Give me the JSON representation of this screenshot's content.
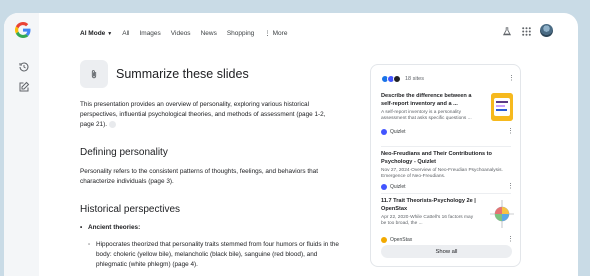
{
  "nav": {
    "items": [
      {
        "label": "AI Mode",
        "active": true,
        "icon": "caret-down"
      },
      {
        "label": "All"
      },
      {
        "label": "Images"
      },
      {
        "label": "Videos"
      },
      {
        "label": "News"
      },
      {
        "label": "Shopping"
      },
      {
        "label": "More",
        "icon": "more-vert"
      }
    ]
  },
  "main": {
    "title": "Summarize these slides",
    "intro": "This presentation provides an overview of personality, exploring various historical perspectives, influential psychological theories, and methods of assessment (page 1-2, page 21).",
    "section1_heading": "Defining personality",
    "section1_text": "Personality refers to the consistent patterns of thoughts, feelings, and behaviors that characterize individuals (page 3).",
    "section2_heading": "Historical perspectives",
    "bullet1": "Ancient theories:",
    "bullet1_sub": "Hippocrates theorized that personality traits stemmed from four humors or fluids in the body: choleric (yellow bile), melancholic (black bile), sanguine (red blood), and phlegmatic (white phlegm) (page 4)."
  },
  "sources": {
    "count_label": "18 sites",
    "cards": [
      {
        "title": "Describe the difference between a self-report inventory and a ...",
        "snippet": "A self-report inventory is a personality assessment that asks specific questions ...",
        "source": "Quizlet"
      },
      {
        "title": "Neo-Freudians and Their Contributions to Psychology - Quizlet",
        "snippet": "Nov 27, 2024·Overview of Neo-Freudian Psychoanalysis. Emergence of Neo-Freudians.",
        "source": "Quizlet"
      },
      {
        "title": "11.7 Trait Theorists-Psychology 2e | OpenStax",
        "snippet": "Apr 22, 2020·While Cattell's 16 factors may be too broad, the ...",
        "source": "OpenStax"
      }
    ],
    "show_all": "Show all"
  },
  "colors": {
    "accent_blue": "#1a73e8",
    "quizlet": "#4255ff",
    "openstax": "#f2a900"
  }
}
